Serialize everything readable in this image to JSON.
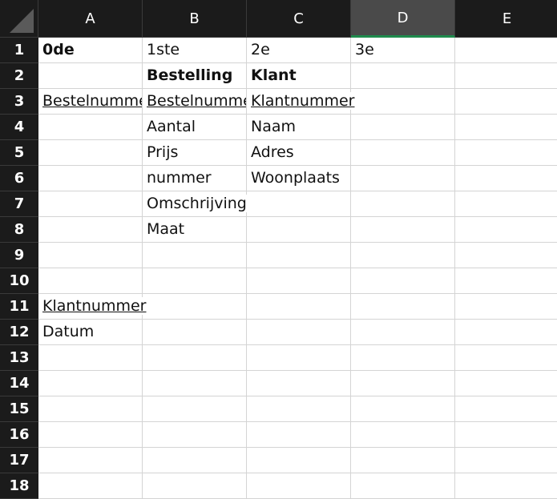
{
  "columns": [
    "A",
    "B",
    "C",
    "D",
    "E"
  ],
  "active_column": "D",
  "rows": [
    "1",
    "2",
    "3",
    "4",
    "5",
    "6",
    "7",
    "8",
    "9",
    "10",
    "11",
    "12",
    "13",
    "14",
    "15",
    "16",
    "17",
    "18"
  ],
  "cells": {
    "A1": "0de",
    "B1": "1ste",
    "C1": "2e",
    "D1": "3e",
    "B2": "Bestelling",
    "C2": "Klant",
    "A3": "Bestelnummer",
    "B3": "Bestelnummer",
    "C3": "Klantnummer",
    "B4": "Aantal",
    "C4": "Naam",
    "B5": "Prijs",
    "C5": "Adres",
    "B6": "nummer",
    "C6": "Woonplaats",
    "B7": "Omschrijving",
    "B8": "Maat",
    "A11": "Klantnummer",
    "A12": "Datum"
  },
  "bold_cells": [
    "A1",
    "B2",
    "C2"
  ],
  "underlined_cells": [
    "A3",
    "B3",
    "C3",
    "A11"
  ],
  "clipped_cells": [
    "A3",
    "B3"
  ]
}
